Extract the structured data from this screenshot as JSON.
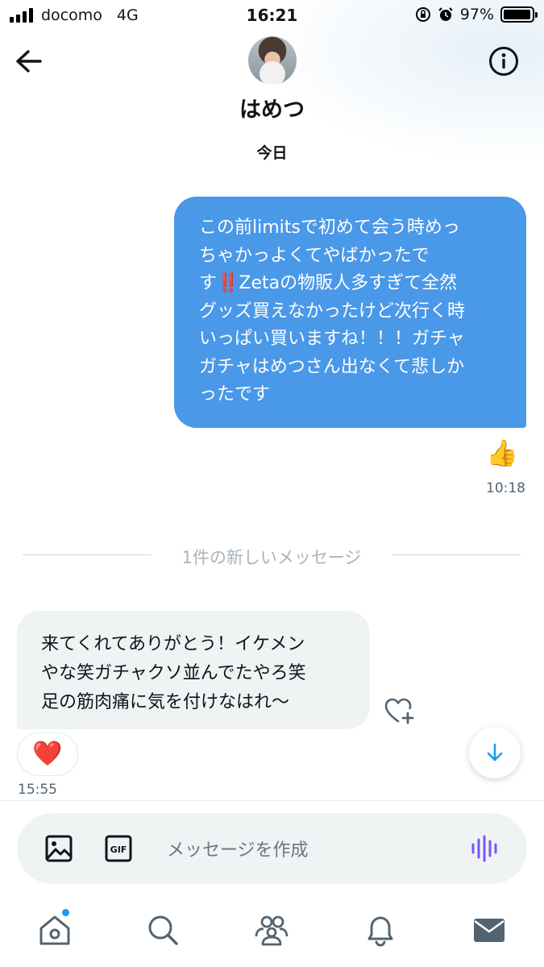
{
  "status_bar": {
    "carrier": "docomo",
    "network": "4G",
    "time": "16:21",
    "battery_percent_label": "97%",
    "battery_level": 0.97
  },
  "header": {
    "contact_name": "はめつ",
    "back_icon": "arrow-left-icon",
    "info_icon": "info-icon"
  },
  "conversation": {
    "date_label": "今日",
    "sent_message": {
      "lines": [
        "この前limitsで初めて会う時めっ",
        "ちゃかっよくてやばかったで",
        "す‼️Zetaの物販人多すぎて全然",
        "グッズ買えなかったけど次行く時",
        "いっぱい買いますね！！！ガチャ",
        "ガチャはめつさん出なくて悲しか",
        "ったです"
      ],
      "reaction": "👍",
      "time": "10:18"
    },
    "new_messages_divider": "1件の新しいメッセージ",
    "received_message": {
      "lines": [
        "来てくれてありがとう！イケメン",
        "やな笑ガチャクソ並んでたやろ笑",
        "足の筋肉痛に気を付けなはれ〜"
      ],
      "reaction": "❤️",
      "time": "15:55"
    }
  },
  "composer": {
    "placeholder": "メッセージを作成",
    "gif_label": "GIF"
  },
  "tabbar": {
    "items": [
      "home-icon",
      "search-icon",
      "communities-icon",
      "notifications-icon",
      "messages-icon"
    ]
  },
  "colors": {
    "sent_bubble": "#4a98e8",
    "received_bubble": "#eff3f4",
    "accent": "#1d9bf0",
    "voice_accent": "#7856ff"
  }
}
